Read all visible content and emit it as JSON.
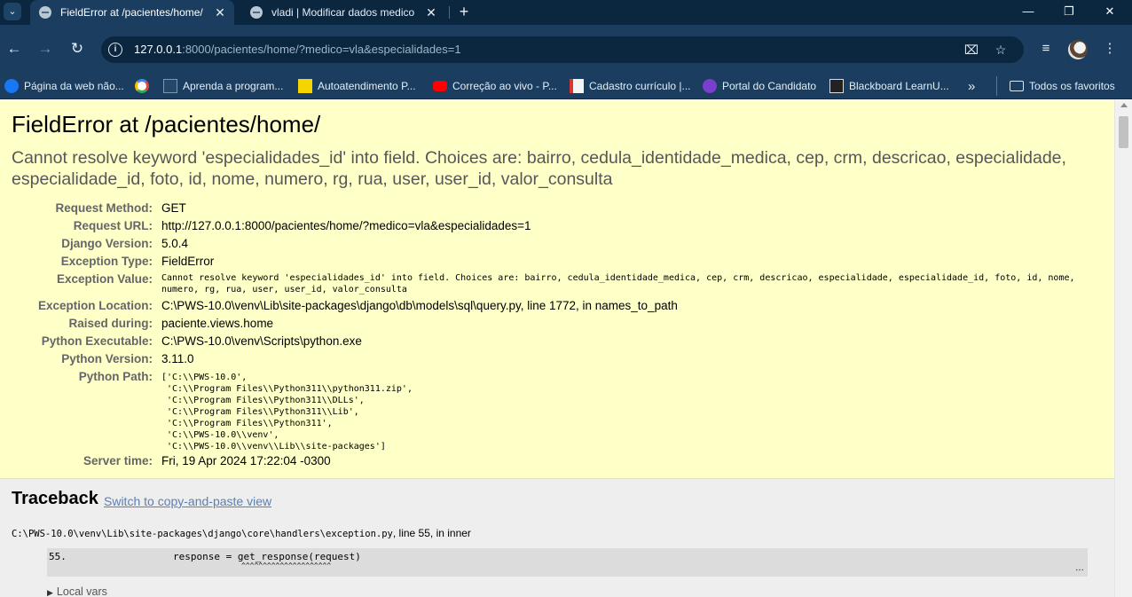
{
  "browser": {
    "tabs": [
      {
        "title": "FieldError at /pacientes/home/",
        "active": true
      },
      {
        "title": "vladi | Modificar dados medico",
        "active": false
      }
    ],
    "new_tab_symbol": "+",
    "close_symbol": "✕",
    "address": {
      "host": "127.0.0.1",
      "rest": ":8000/pacientes/home/?medico=vla&especialidades=1"
    },
    "bookmarks": [
      {
        "label": "Página da web não...",
        "icon": "facebook-icon",
        "color": "#1877f2"
      },
      {
        "label": "",
        "icon": "google-icon",
        "color": "#ffffff"
      },
      {
        "label": "Aprenda a program...",
        "icon": "page-icon",
        "color": "#3b5b7a"
      },
      {
        "label": "Autoatendimento P...",
        "icon": "bank-icon",
        "color": "#f5d400"
      },
      {
        "label": "Correção ao vivo - P...",
        "icon": "youtube-icon",
        "color": "#ff0000"
      },
      {
        "label": "Cadastro currículo |...",
        "icon": "form-icon",
        "color": "#d33"
      },
      {
        "label": "Portal do Candidato",
        "icon": "k-icon",
        "color": "#7b3fd0"
      },
      {
        "label": "Blackboard LearnU...",
        "icon": "blackboard-icon",
        "color": "#222222"
      }
    ],
    "more_bookmarks": "»",
    "all_bookmarks": "Todos os favoritos"
  },
  "error": {
    "title": "FieldError at /pacientes/home/",
    "message": "Cannot resolve keyword 'especialidades_id' into field. Choices are: bairro, cedula_identidade_medica, cep, crm, descricao, especialidade, especialidade_id, foto, id, nome, numero, rg, rua, user, user_id, valor_consulta",
    "meta": {
      "request_method": {
        "label": "Request Method:",
        "value": "GET"
      },
      "request_url": {
        "label": "Request URL:",
        "value": "http://127.0.0.1:8000/pacientes/home/?medico=vla&especialidades=1"
      },
      "django_version": {
        "label": "Django Version:",
        "value": "5.0.4"
      },
      "exception_type": {
        "label": "Exception Type:",
        "value": "FieldError"
      },
      "exception_value": {
        "label": "Exception Value:",
        "value": "Cannot resolve keyword 'especialidades_id' into field. Choices are: bairro, cedula_identidade_medica, cep, crm, descricao, especialidade, especialidade_id, foto, id, nome, numero, rg, rua, user, user_id, valor_consulta"
      },
      "exception_location": {
        "label": "Exception Location:",
        "value": "C:\\PWS-10.0\\venv\\Lib\\site-packages\\django\\db\\models\\sql\\query.py, line 1772, in names_to_path"
      },
      "raised_during": {
        "label": "Raised during:",
        "value": "paciente.views.home"
      },
      "python_executable": {
        "label": "Python Executable:",
        "value": "C:\\PWS-10.0\\venv\\Scripts\\python.exe"
      },
      "python_version": {
        "label": "Python Version:",
        "value": "3.11.0"
      },
      "python_path": {
        "label": "Python Path:",
        "value": "['C:\\\\PWS-10.0',\n 'C:\\\\Program Files\\\\Python311\\\\python311.zip',\n 'C:\\\\Program Files\\\\Python311\\\\DLLs',\n 'C:\\\\Program Files\\\\Python311\\\\Lib',\n 'C:\\\\Program Files\\\\Python311',\n 'C:\\\\PWS-10.0\\\\venv',\n 'C:\\\\PWS-10.0\\\\venv\\\\Lib\\\\site-packages']"
      },
      "server_time": {
        "label": "Server time:",
        "value": "Fri, 19 Apr 2024 17:22:04 -0300"
      }
    }
  },
  "traceback": {
    "heading": "Traceback",
    "switch_link": "Switch to copy-and-paste view",
    "frame_path": "C:\\PWS-10.0\\venv\\Lib\\site-packages\\django\\core\\handlers\\exception.py",
    "frame_location": ", line 55, in inner",
    "line_number": "55.",
    "code": "response = get_response(request)",
    "caret": "^^^^^^^^^^^^^^^^^^^^^",
    "ellipsis": "…",
    "local_vars": "Local vars"
  }
}
